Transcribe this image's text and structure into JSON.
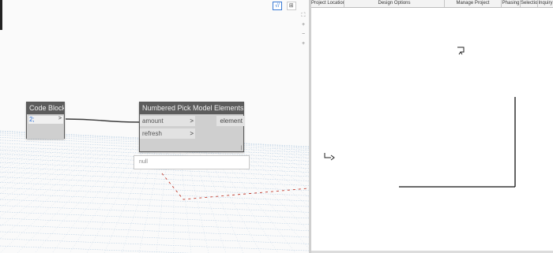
{
  "canvas": {
    "view_toggle": [
      {
        "label": "√/",
        "active": true
      },
      {
        "label": "⊞",
        "active": false
      }
    ],
    "zoom_controls": [
      "⛶",
      "+",
      "−",
      "+"
    ],
    "wire_color": "#3b3b3b",
    "selection_dash_color": "#c0392b"
  },
  "code_block": {
    "title": "Code Block",
    "code": "2;",
    "output_port": ">"
  },
  "pick_node": {
    "title": "Numbered Pick Model Elements",
    "inputs": [
      {
        "label": "amount",
        "arrow": ">"
      },
      {
        "label": "refresh",
        "arrow": ">"
      }
    ],
    "output": "element",
    "corner_mark": "|",
    "preview_text": "null"
  },
  "revit": {
    "ribbon": [
      "Project Location",
      "Design Options",
      "Manage Project",
      "Phasing",
      "Selection",
      "Inquiry"
    ]
  }
}
